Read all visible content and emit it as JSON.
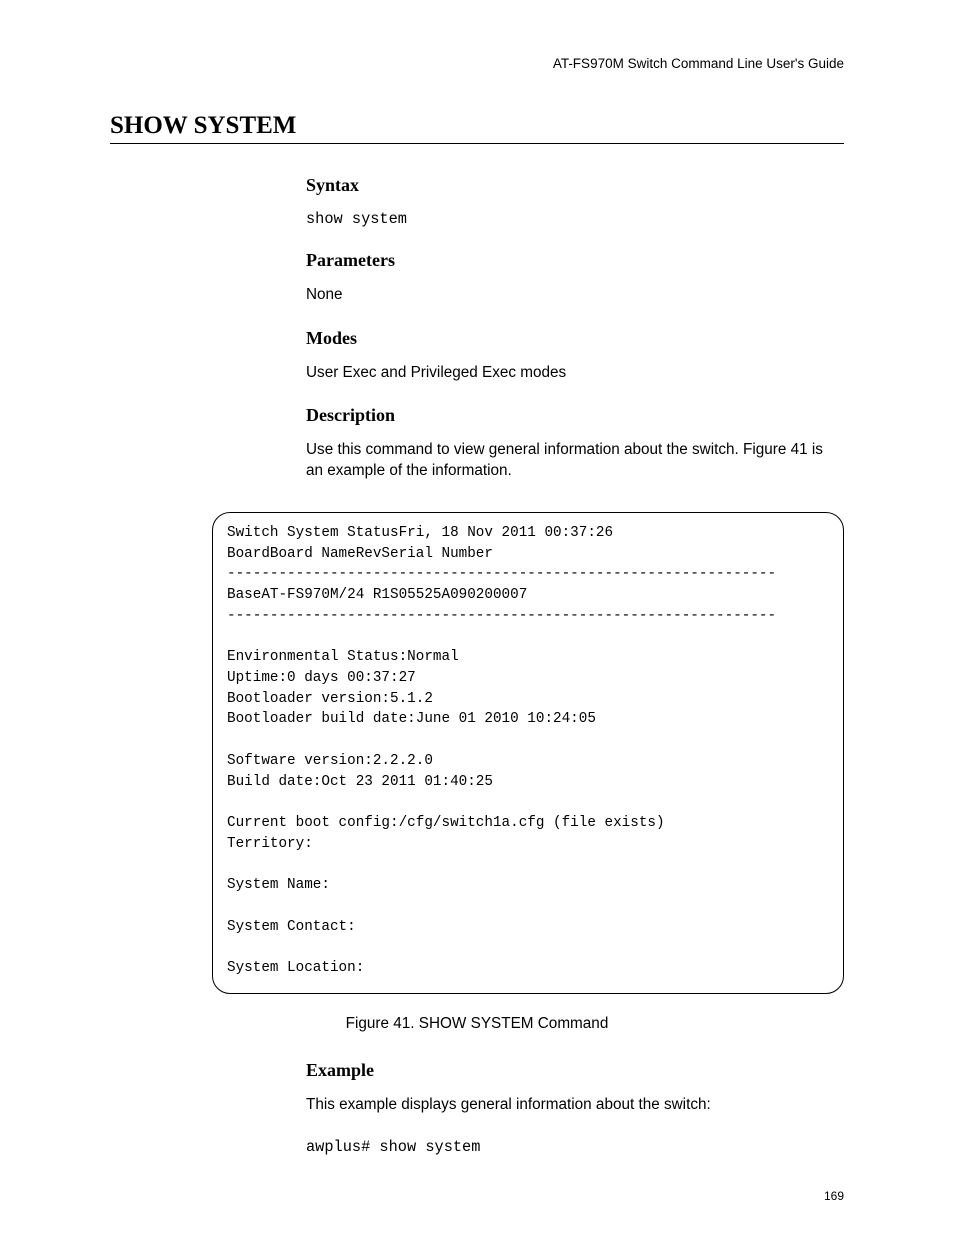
{
  "header": "AT-FS970M Switch Command Line User's Guide",
  "title": "SHOW SYSTEM",
  "sections": {
    "syntax": {
      "heading": "Syntax",
      "text": "show system"
    },
    "parameters": {
      "heading": "Parameters",
      "text": "None"
    },
    "modes": {
      "heading": "Modes",
      "text": "User Exec and Privileged Exec modes"
    },
    "description": {
      "heading": "Description",
      "text": "Use this command to view general information about the switch. Figure 41 is an example of the information."
    },
    "example": {
      "heading": "Example",
      "intro": "This example displays general information about the switch:",
      "command": "awplus# show system"
    }
  },
  "code_output": "Switch System StatusFri, 18 Nov 2011 00:37:26\nBoardBoard NameRevSerial Number\n----------------------------------------------------------------\nBaseAT-FS970M/24 R1S05525A090200007\n----------------------------------------------------------------\n\nEnvironmental Status:Normal\nUptime:0 days 00:37:27\nBootloader version:5.1.2\nBootloader build date:June 01 2010 10:24:05\n\nSoftware version:2.2.2.0\nBuild date:Oct 23 2011 01:40:25\n\nCurrent boot config:/cfg/switch1a.cfg (file exists)\nTerritory:\n\nSystem Name:\n\nSystem Contact:\n\nSystem Location:",
  "figure_caption": "Figure 41. SHOW SYSTEM Command",
  "page_number": "169"
}
